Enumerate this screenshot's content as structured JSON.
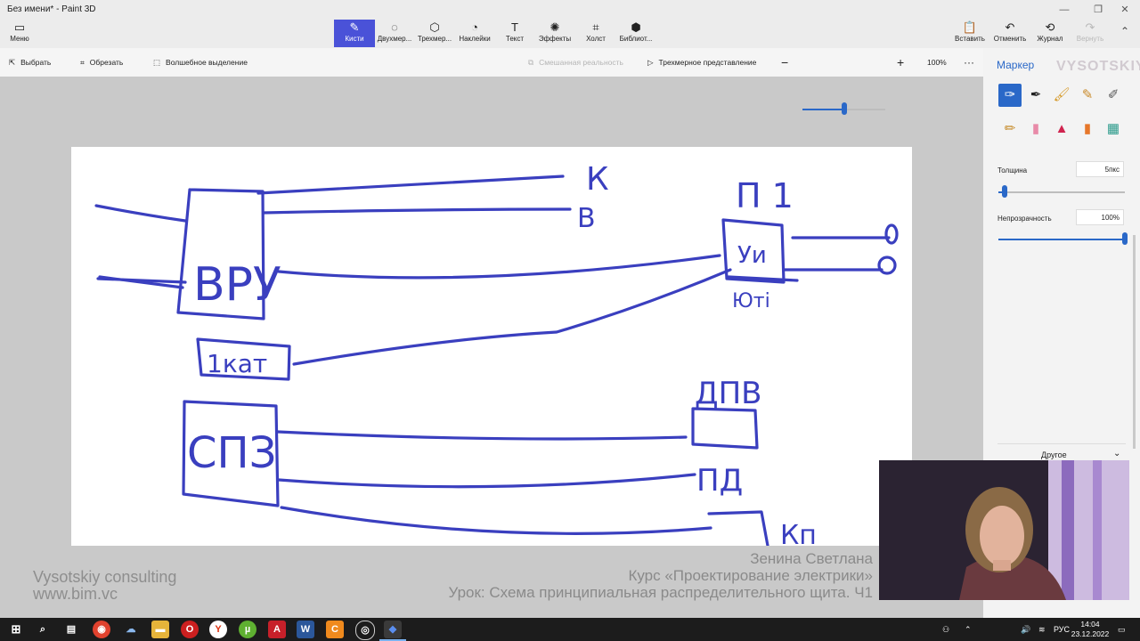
{
  "window": {
    "title": "Без имени* - Paint 3D",
    "minimize_glyph": "—",
    "maximize_glyph": "❐",
    "close_glyph": "✕"
  },
  "menu": {
    "label": "Меню",
    "icon": "folder-icon"
  },
  "ribbon": {
    "tabs": [
      {
        "label": "Кисти",
        "icon": "brush-icon",
        "active": true
      },
      {
        "label": "Двухмер...",
        "icon": "shapes-2d-icon"
      },
      {
        "label": "Трехмер...",
        "icon": "shapes-3d-icon"
      },
      {
        "label": "Наклейки",
        "icon": "sticker-icon"
      },
      {
        "label": "Текст",
        "icon": "text-icon"
      },
      {
        "label": "Эффекты",
        "icon": "effects-icon"
      },
      {
        "label": "Холст",
        "icon": "canvas-icon"
      },
      {
        "label": "Библиот...",
        "icon": "library-icon"
      }
    ],
    "right": [
      {
        "label": "Вставить",
        "icon": "paste-icon"
      },
      {
        "label": "Отменить",
        "icon": "undo-icon"
      },
      {
        "label": "Журнал",
        "icon": "history-icon"
      },
      {
        "label": "Вернуть",
        "icon": "redo-icon",
        "disabled": true
      }
    ],
    "accent_color": "#4a52d8"
  },
  "toolbar": {
    "select": "Выбрать",
    "crop": "Обрезать",
    "magic_select": "Волшебное выделение",
    "mixed_reality": "Смешанная реальность",
    "view_3d": "Трехмерное представление",
    "zoom_minus": "−",
    "zoom_plus": "+",
    "zoom_value": "100%",
    "zoom_level": 0.5,
    "more": "···"
  },
  "panel": {
    "title": "Маркер",
    "tools": [
      "marker-icon",
      "calligraphy-pen-icon",
      "oil-brush-icon",
      "watercolor-icon",
      "pixel-pen-icon",
      "pencil-icon",
      "eraser-icon",
      "crayon-icon",
      "spray-can-icon",
      "fill-icon"
    ],
    "thickness_label": "Толщина",
    "thickness_value": "5пкс",
    "thickness_level": 0.05,
    "opacity_label": "Непрозрачность",
    "opacity_value": "100%",
    "opacity_level": 1.0,
    "other_label": "Другое"
  },
  "drawing": {
    "ink_color": "#3a3fbf",
    "labels": {
      "vru": "ВРУ",
      "k": "К",
      "v": "В",
      "p1": "П 1",
      "ui": "Уи",
      "yomi": "Юті",
      "one_kat": "1кат",
      "spz": "СПЗ",
      "dpv": "ДПВ",
      "pd": "ПД",
      "kp": "Кп"
    }
  },
  "overlay": {
    "watermark_line1": "Vysotskiy consulting",
    "watermark_line2": "www.bim.vc",
    "author": "Зенина Светлана",
    "course": "Курс «Проектирование электрики»",
    "lesson": "Урок: Схема принципиальная распределительного щита. Ч1",
    "logo": "VYSOTSKIY"
  },
  "taskbar": {
    "apps": [
      "windows-start-icon",
      "search-icon",
      "task-view-icon",
      "chrome-icon",
      "cloud-icon",
      "file-explorer-icon",
      "opera-icon",
      "yandex-icon",
      "utorrent-icon",
      "autocad-icon",
      "word-icon",
      "app-c-icon",
      "capture-icon",
      "paint3d-icon"
    ],
    "lang": "РУС",
    "time": "14:04",
    "date": "23.12.2022"
  }
}
